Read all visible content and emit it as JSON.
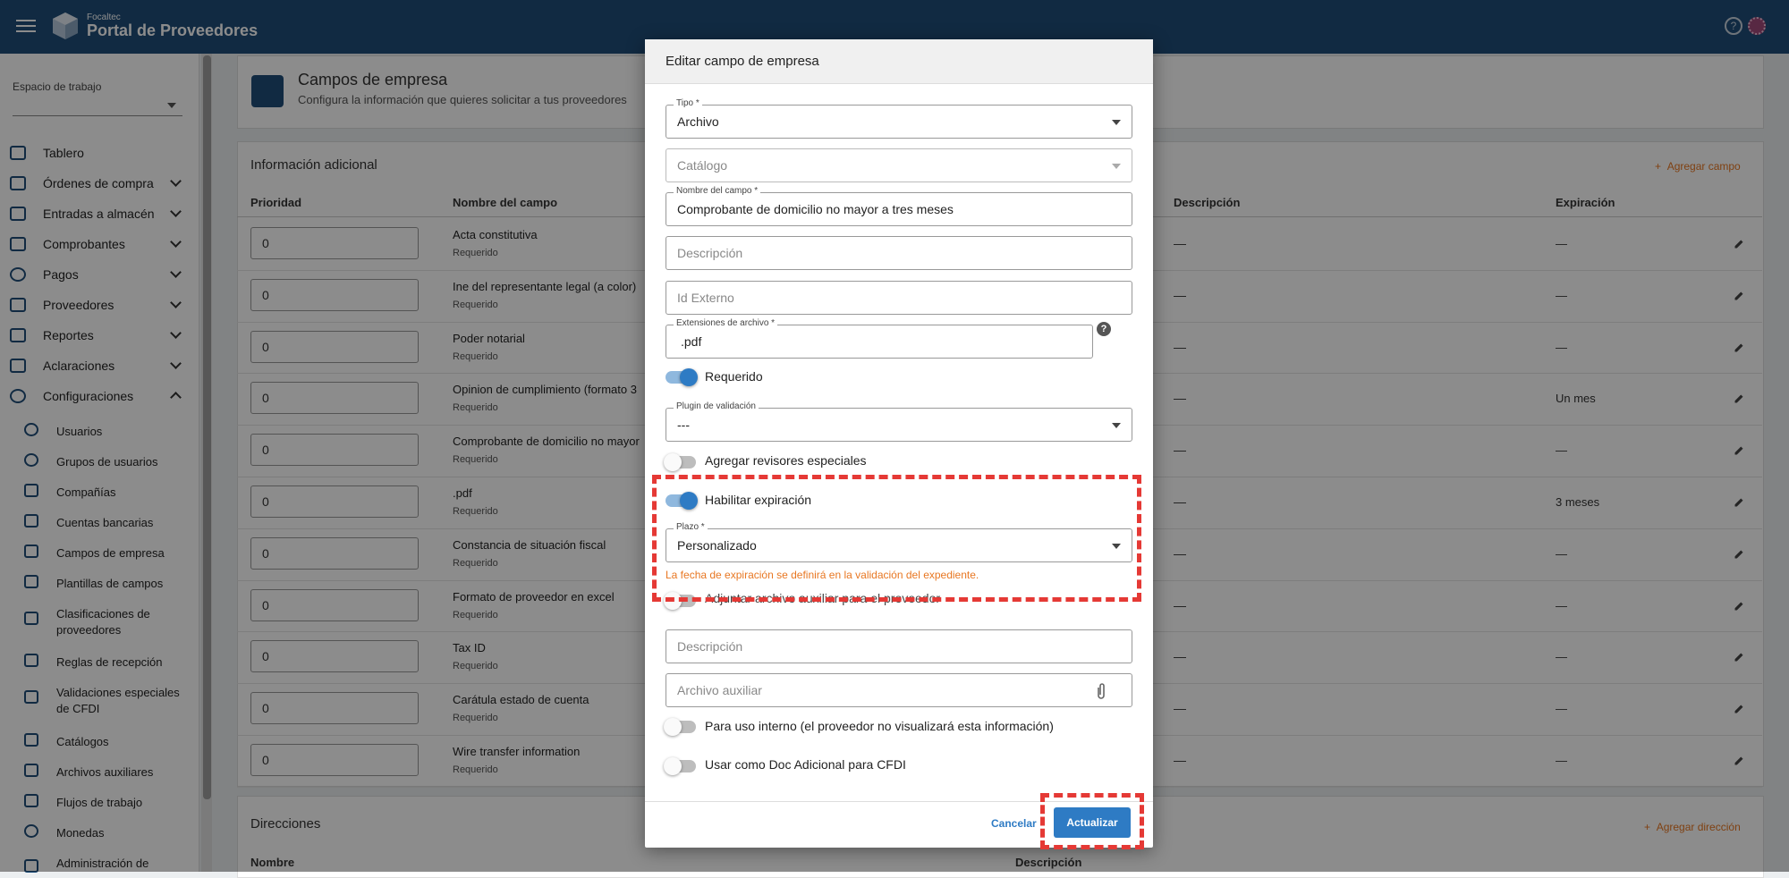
{
  "header": {
    "company": "Focaltec",
    "app_name": "Portal de Proveedores"
  },
  "sidebar": {
    "workspace_label": "Espacio de trabajo",
    "items": [
      {
        "label": "Tablero",
        "icon": "dashboard-icon"
      },
      {
        "label": "Órdenes de compra",
        "icon": "purchase-orders-icon"
      },
      {
        "label": "Entradas a almacén",
        "icon": "truck-icon"
      },
      {
        "label": "Comprobantes",
        "icon": "document-icon"
      },
      {
        "label": "Pagos",
        "icon": "dollar-icon"
      },
      {
        "label": "Proveedores",
        "icon": "building-icon"
      },
      {
        "label": "Reportes",
        "icon": "report-icon"
      },
      {
        "label": "Aclaraciones",
        "icon": "mail-icon"
      },
      {
        "label": "Configuraciones",
        "icon": "gear-icon"
      }
    ],
    "sub_items": [
      {
        "label": "Usuarios",
        "icon": "user-icon"
      },
      {
        "label": "Grupos de usuarios",
        "icon": "users-group-icon"
      },
      {
        "label": "Compañías",
        "icon": "briefcase-icon"
      },
      {
        "label": "Cuentas bancarias",
        "icon": "list-icon"
      },
      {
        "label": "Campos de empresa",
        "icon": "fields-icon"
      },
      {
        "label": "Plantillas de campos",
        "icon": "template-icon"
      },
      {
        "label": "Clasificaciones de proveedores",
        "icon": "book-icon"
      },
      {
        "label": "Reglas de recepción",
        "icon": "rules-icon"
      },
      {
        "label": "Validaciones especiales de CFDI",
        "icon": "validation-icon"
      },
      {
        "label": "Catálogos",
        "icon": "catalog-icon"
      },
      {
        "label": "Archivos auxiliares",
        "icon": "files-icon"
      },
      {
        "label": "Flujos de trabajo",
        "icon": "workflow-icon"
      },
      {
        "label": "Monedas",
        "icon": "currency-icon"
      },
      {
        "label": "Administración de",
        "icon": "admin-icon"
      }
    ]
  },
  "page": {
    "title": "Campos de empresa",
    "subtitle": "Configura la información que quieres solicitar a tus proveedores",
    "section_info": "Información adicional",
    "add_field": "Agregar campo",
    "columns": [
      "Prioridad",
      "Nombre del campo",
      "Descripción",
      "Expiración"
    ],
    "required_text": "Requerido",
    "rows": [
      {
        "priority": "0",
        "name": "Acta constitutiva",
        "desc": "—",
        "exp": "—"
      },
      {
        "priority": "0",
        "name": "Ine del representante legal (a color)",
        "desc": "—",
        "exp": "—"
      },
      {
        "priority": "0",
        "name": "Poder notarial",
        "desc": "—",
        "exp": "—"
      },
      {
        "priority": "0",
        "name": "Opinion de cumplimiento (formato 3",
        "desc": "—",
        "exp": "Un mes"
      },
      {
        "priority": "0",
        "name": "Comprobante de domicilio no mayor",
        "desc": "—",
        "exp": "—"
      },
      {
        "priority": "0",
        "name": ".pdf",
        "desc": "—",
        "exp": "3 meses"
      },
      {
        "priority": "0",
        "name": "Constancia de situación fiscal",
        "desc": "—",
        "exp": "—"
      },
      {
        "priority": "0",
        "name": "Formato de proveedor en excel",
        "desc": "—",
        "exp": "—"
      },
      {
        "priority": "0",
        "name": "Tax ID",
        "desc": "—",
        "exp": "—"
      },
      {
        "priority": "0",
        "name": "Carátula estado de cuenta",
        "desc": "—",
        "exp": "—"
      },
      {
        "priority": "0",
        "name": "Wire transfer information",
        "desc": "—",
        "exp": "—"
      }
    ],
    "section_addresses": "Direcciones",
    "add_address": "Agregar dirección",
    "addr_columns": [
      "Nombre",
      "Descripción"
    ]
  },
  "dialog": {
    "title": "Editar campo de empresa",
    "tipo_label": "Tipo *",
    "tipo_value": "Archivo",
    "catalogo_placeholder": "Catálogo",
    "nombre_label": "Nombre del campo *",
    "nombre_value": "Comprobante de domicilio no mayor a tres meses",
    "descripcion_placeholder": "Descripción",
    "id_externo_placeholder": "Id Externo",
    "extensiones_label": "Extensiones de archivo *",
    "extensiones_value": ".pdf",
    "help_glyph": "?",
    "requerido_label": "Requerido",
    "requerido_on": true,
    "plugin_label": "Plugin de validación",
    "plugin_value": "---",
    "revisores_label": "Agregar revisores especiales",
    "revisores_on": false,
    "expiracion_label": "Habilitar expiración",
    "expiracion_on": true,
    "plazo_label": "Plazo *",
    "plazo_value": "Personalizado",
    "plazo_hint": "La fecha de expiración se definirá en la validación del expediente.",
    "adjuntar_label": "Adjuntar archivo auxiliar para el proveedor",
    "desc2_placeholder": "Descripción",
    "archivo_aux_placeholder": "Archivo auxiliar",
    "uso_interno_label": "Para uso interno (el proveedor no visualizará esta información)",
    "uso_interno_on": false,
    "doc_adicional_label": "Usar como Doc Adicional para CFDI",
    "doc_adicional_on": false,
    "cancel_label": "Cancelar",
    "update_label": "Actualizar"
  },
  "colors": {
    "topbar": "#1f4e79",
    "accent": "#2e7bc4",
    "warning": "#e87722",
    "highlight": "#e53935"
  }
}
